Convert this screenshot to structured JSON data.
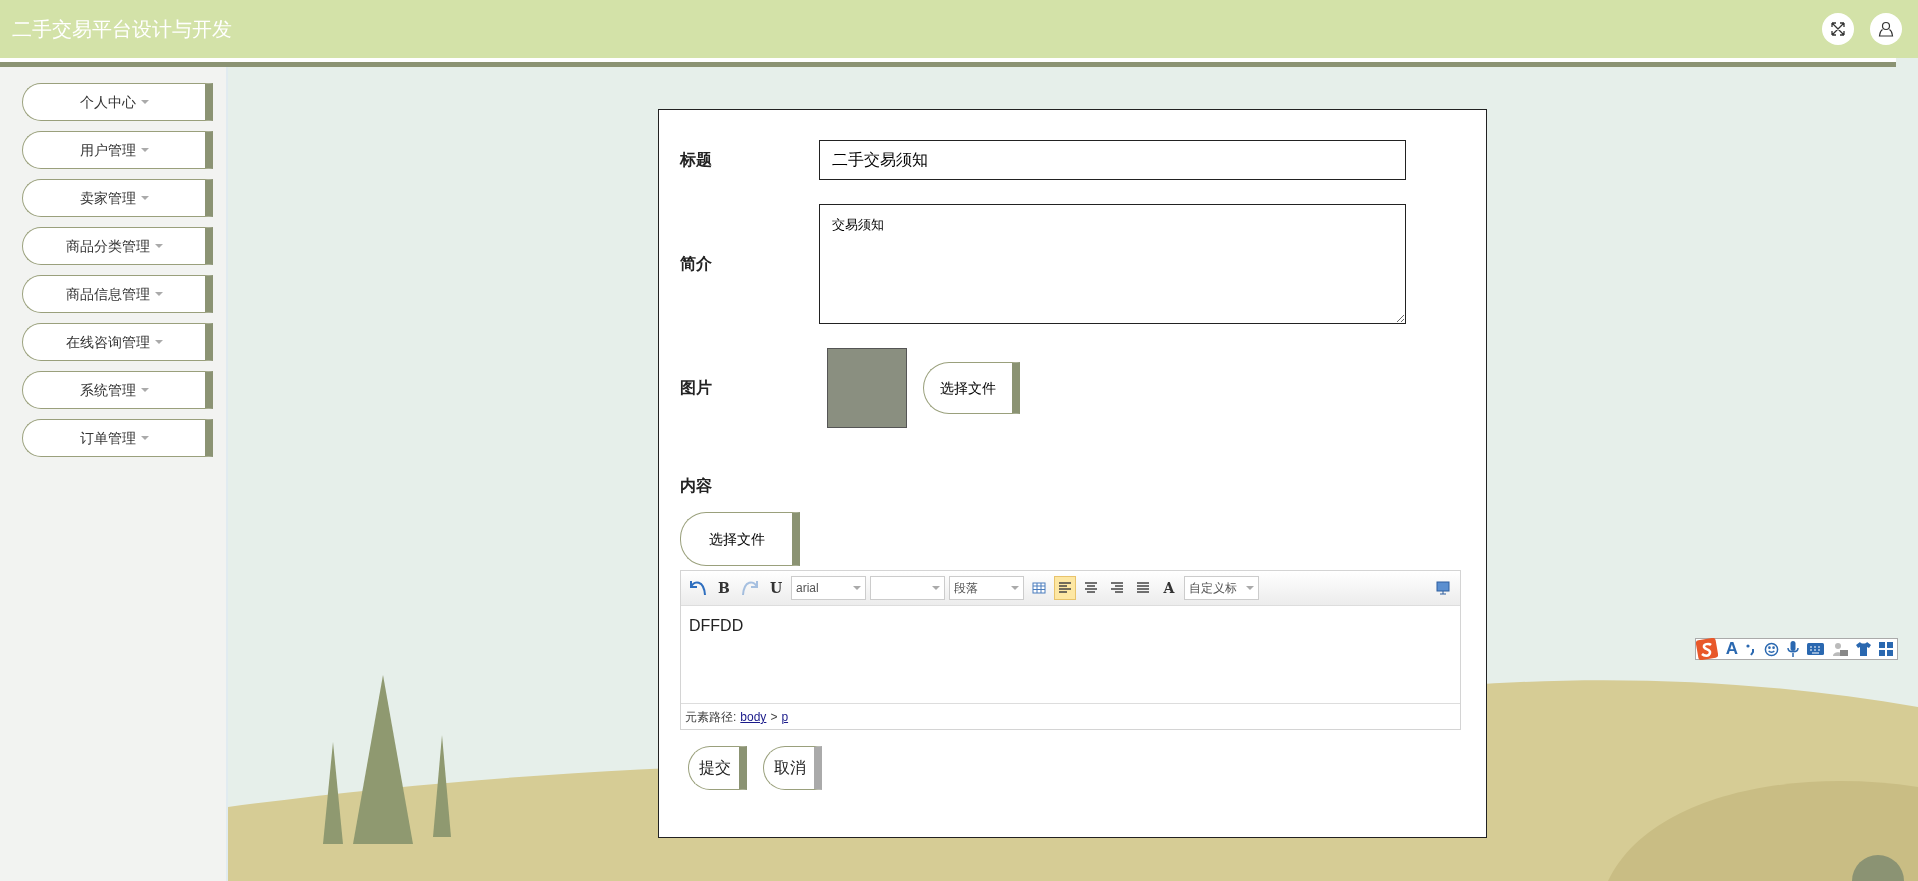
{
  "header": {
    "title": "二手交易平台设计与开发"
  },
  "sidebar": {
    "items": [
      {
        "label": "个人中心"
      },
      {
        "label": "用户管理"
      },
      {
        "label": "卖家管理"
      },
      {
        "label": "商品分类管理"
      },
      {
        "label": "商品信息管理"
      },
      {
        "label": "在线咨询管理"
      },
      {
        "label": "系统管理"
      },
      {
        "label": "订单管理"
      }
    ]
  },
  "form": {
    "fields": [
      {
        "kind": "text",
        "label": "标题",
        "value": "二手交易须知"
      },
      {
        "kind": "textarea",
        "label": "简介",
        "value": "交易须知"
      },
      {
        "kind": "image",
        "label": "图片",
        "button": "选择文件"
      },
      {
        "kind": "editor",
        "label": "内容",
        "upload_button": "选择文件",
        "content": "DFFDD",
        "path_label": "元素路径:",
        "path": [
          "body",
          "p"
        ],
        "path_separator": ">",
        "toolbar": [
          {
            "kind": "icon",
            "active": false,
            "disabled": false
          },
          {
            "kind": "glyph",
            "label": "B",
            "active": false,
            "disabled": false
          },
          {
            "kind": "icon",
            "active": false,
            "disabled": true
          },
          {
            "kind": "glyph",
            "label": "U",
            "active": false,
            "disabled": false
          },
          {
            "kind": "select",
            "value": "arial"
          },
          {
            "kind": "select"
          },
          {
            "kind": "select",
            "value": "段落"
          },
          {
            "kind": "icon",
            "active": false,
            "disabled": false
          },
          {
            "kind": "icon",
            "active": true,
            "disabled": false
          },
          {
            "kind": "icon",
            "active": false,
            "disabled": false
          },
          {
            "kind": "icon",
            "active": false,
            "disabled": false
          },
          {
            "kind": "icon",
            "active": false,
            "disabled": false
          },
          {
            "kind": "glyph",
            "label": "A",
            "active": false,
            "disabled": false
          },
          {
            "kind": "select",
            "value": "自定义标"
          },
          {
            "kind": "icon",
            "active": false,
            "disabled": false
          }
        ]
      }
    ],
    "buttons": [
      {
        "label": "提交",
        "kind": "primary"
      },
      {
        "label": "取消",
        "kind": "secondary"
      }
    ]
  },
  "ime_toolbar": {
    "glyph": "A"
  }
}
